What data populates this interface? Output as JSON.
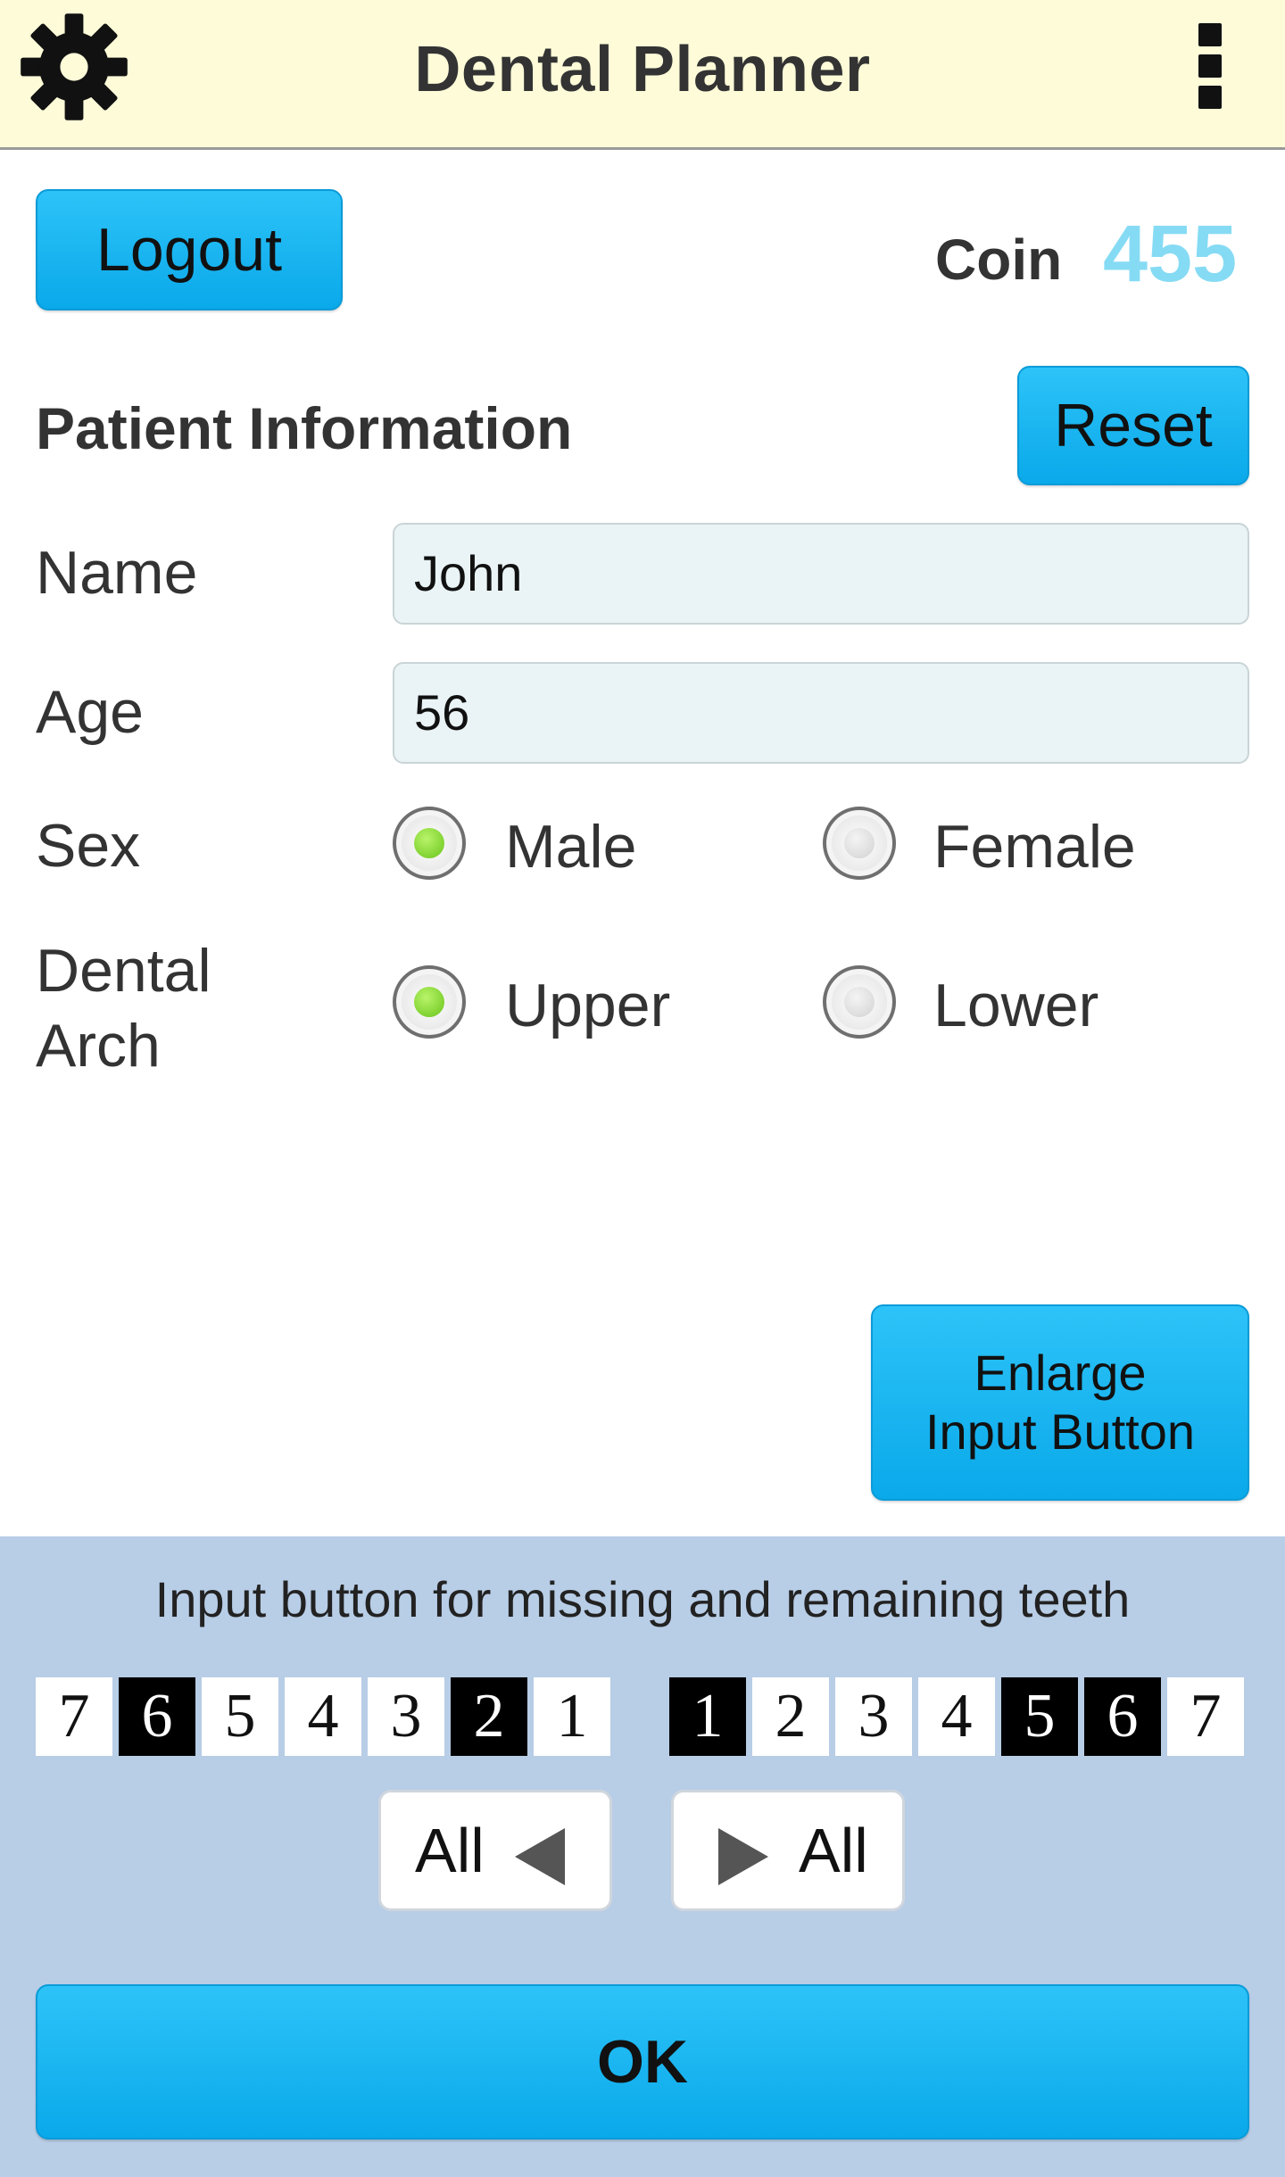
{
  "app": {
    "title": "Dental Planner",
    "icons": {
      "settings": "gear-icon",
      "menu": "overflow-menu-icon"
    }
  },
  "account": {
    "logout_label": "Logout",
    "coin_label": "Coin",
    "coin_value": "455"
  },
  "patient": {
    "section_title": "Patient Information",
    "reset_label": "Reset",
    "name_label": "Name",
    "name_value": "John",
    "age_label": "Age",
    "age_value": "56",
    "sex_label": "Sex",
    "sex_options": [
      {
        "label": "Male",
        "selected": true
      },
      {
        "label": "Female",
        "selected": false
      }
    ],
    "arch_label_line1": "Dental",
    "arch_label_line2": "Arch",
    "arch_options": [
      {
        "label": "Upper",
        "selected": true
      },
      {
        "label": "Lower",
        "selected": false
      }
    ]
  },
  "enlarge": {
    "line1": "Enlarge",
    "line2": "Input Button"
  },
  "teeth_panel": {
    "hint": "Input button for missing and remaining teeth",
    "right_side": [
      {
        "label": "7",
        "selected": false
      },
      {
        "label": "6",
        "selected": true
      },
      {
        "label": "5",
        "selected": false
      },
      {
        "label": "4",
        "selected": false
      },
      {
        "label": "3",
        "selected": false
      },
      {
        "label": "2",
        "selected": true
      },
      {
        "label": "1",
        "selected": false
      }
    ],
    "left_side": [
      {
        "label": "1",
        "selected": true
      },
      {
        "label": "2",
        "selected": false
      },
      {
        "label": "3",
        "selected": false
      },
      {
        "label": "4",
        "selected": false
      },
      {
        "label": "5",
        "selected": true
      },
      {
        "label": "6",
        "selected": true
      },
      {
        "label": "7",
        "selected": false
      }
    ],
    "all_left_label": "All",
    "all_right_label": "All",
    "ok_label": "OK"
  },
  "colors": {
    "appbar_bg": "#fdfbd8",
    "accent_blue": "#14b2ef",
    "coin_color": "#86dbf4",
    "bottom_panel_bg": "#b8cde6",
    "radio_selected": "#68c41a"
  }
}
